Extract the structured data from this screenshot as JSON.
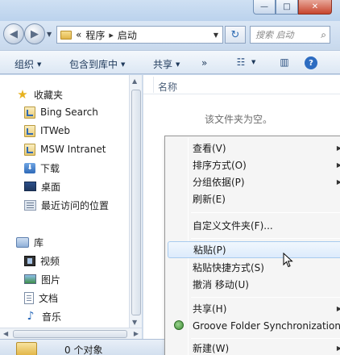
{
  "window": {
    "minimize": "—",
    "maximize": "□",
    "close": "✕"
  },
  "address": {
    "prefix": "«",
    "path": [
      "程序",
      "启动"
    ],
    "separator": "▸",
    "search_placeholder": "搜索 启动"
  },
  "toolbar": {
    "organize": "组织",
    "include_library": "包含到库中",
    "share": "共享",
    "more": "»",
    "view_icon": "view-options-icon",
    "preview_icon": "preview-pane-icon",
    "help": "?"
  },
  "navigation": {
    "favorites": "收藏夹",
    "favorites_items": [
      "Bing Search",
      "ITWeb",
      "MSW Intranet",
      "下载",
      "桌面",
      "最近访问的位置"
    ],
    "libraries": "库",
    "libraries_items": [
      "视频",
      "图片",
      "文档",
      "音乐"
    ]
  },
  "content": {
    "column_name": "名称",
    "empty_message": "该文件夹为空。"
  },
  "status": {
    "count_text": "0 个对象"
  },
  "context_menu": {
    "view": "查看(V)",
    "sort_by": "排序方式(O)",
    "group_by": "分组依据(P)",
    "refresh": "刷新(E)",
    "customize": "自定义文件夹(F)...",
    "paste": "粘贴(P)",
    "paste_shortcut": "粘贴快捷方式(S)",
    "undo_move": "撤消 移动(U)",
    "share": "共享(H)",
    "groove_sync": "Groove Folder Synchronization",
    "new": "新建(W)"
  }
}
